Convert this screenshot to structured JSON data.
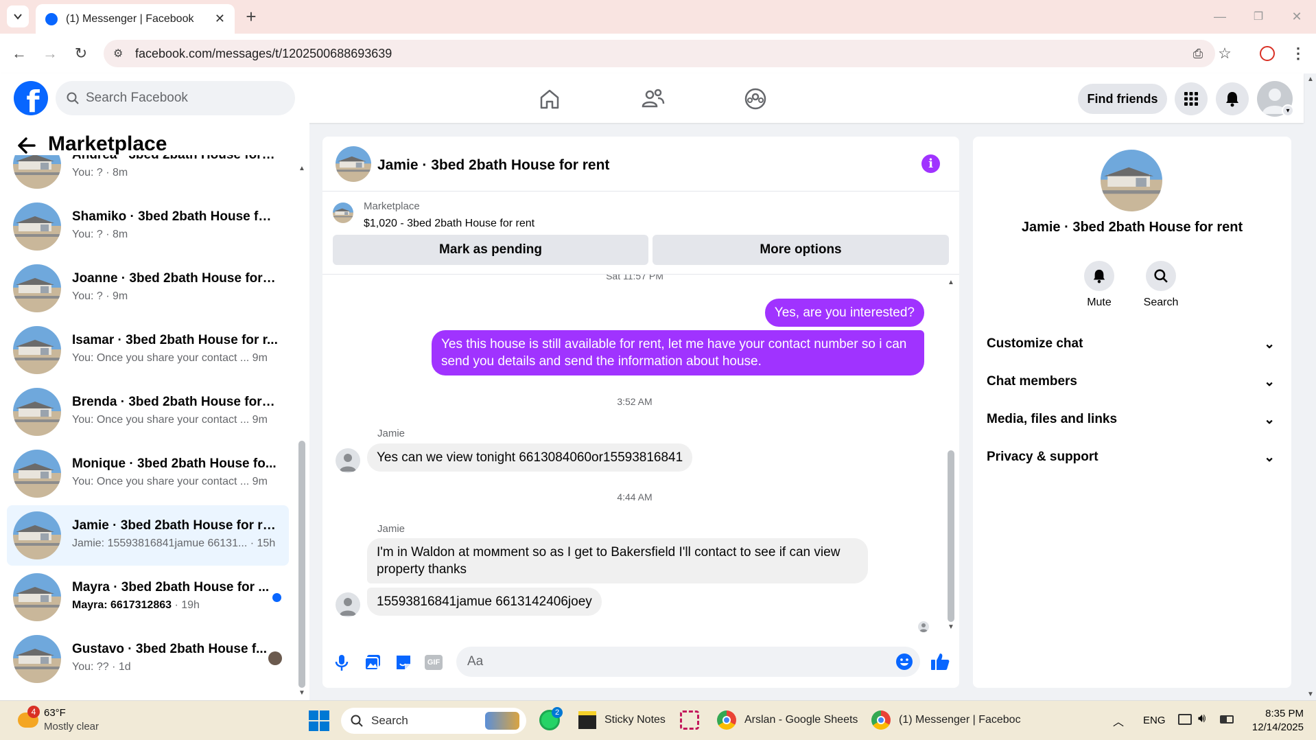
{
  "browser": {
    "tab_title": "(1) Messenger | Facebook",
    "url": "facebook.com/messages/t/1202500688693639"
  },
  "fb": {
    "search_placeholder": "Search Facebook",
    "find_friends": "Find friends"
  },
  "left": {
    "title": "Marketplace",
    "conversations": [
      {
        "name": "Andrea · 3bed 2bath House for r...",
        "snippet": "You: ? · 8m",
        "active": false,
        "unread": false
      },
      {
        "name": "Shamiko · 3bed 2bath House for...",
        "snippet": "You: ? · 8m",
        "active": false,
        "unread": false
      },
      {
        "name": "Joanne · 3bed 2bath House for r...",
        "snippet": "You: ? · 9m",
        "active": false,
        "unread": false
      },
      {
        "name": "Isamar · 3bed 2bath House for r...",
        "snippet": "You: Once you share your contact ...  9m",
        "active": false,
        "unread": false
      },
      {
        "name": "Brenda · 3bed 2bath House for r...",
        "snippet": "You: Once you share your contact ...  9m",
        "active": false,
        "unread": false
      },
      {
        "name": "Monique · 3bed 2bath House fo...",
        "snippet": "You: Once you share your contact ...  9m",
        "active": false,
        "unread": false
      },
      {
        "name": "Jamie · 3bed 2bath House for rent",
        "snippet": "Jamie: 15593816841jamue 66131...  · 15h",
        "active": true,
        "unread": false
      },
      {
        "name": "Mayra · 3bed 2bath House for ...",
        "snippet_bold": "Mayra: 6617312863",
        "snippet_rest": " · 19h",
        "active": false,
        "unread": true
      },
      {
        "name": "Gustavo · 3bed 2bath House f...",
        "snippet": "You: ?? · 1d",
        "active": false,
        "unread": false
      }
    ]
  },
  "chat": {
    "title": "Jamie · 3bed 2bath House for rent",
    "marketplace_label": "Marketplace",
    "listing": "$1,020 - 3bed 2bath House for rent",
    "mark_pending": "Mark as pending",
    "more_options": "More options",
    "ts_top": "Sat 11:57 PM",
    "msg_out_1": "Yes, are you interested?",
    "msg_out_2": "Yes this house is still available for rent, let me have your contact number so i can send you details and send the information about house.",
    "ts_2": "3:52 AM",
    "sender_1": "Jamie",
    "msg_in_1": "Yes can we view tonight 6613084060or15593816841",
    "ts_3": "4:44 AM",
    "sender_2": "Jamie",
    "msg_in_2": "I'm in Waldon at mомment so as I get to Bakersfield I'll contact to see if can view property thanks",
    "msg_in_3": "15593816841jamue 6613142406joey",
    "composer_placeholder": "Aa",
    "accent": "#a033ff"
  },
  "right": {
    "title": "Jamie · 3bed 2bath House for rent",
    "mute": "Mute",
    "search": "Search",
    "sections": [
      "Customize chat",
      "Chat members",
      "Media, files and links",
      "Privacy & support"
    ]
  },
  "taskbar": {
    "badge_weather": "4",
    "temp": "63°F",
    "weather": "Mostly clear",
    "search": "Search",
    "whatsapp_badge": "2",
    "sticky": "Sticky Notes",
    "sheets": "Arslan - Google Sheets",
    "messenger": "(1) Messenger | Faceboc",
    "lang": "ENG",
    "time": "8:35 PM",
    "date": "12/14/2025"
  }
}
